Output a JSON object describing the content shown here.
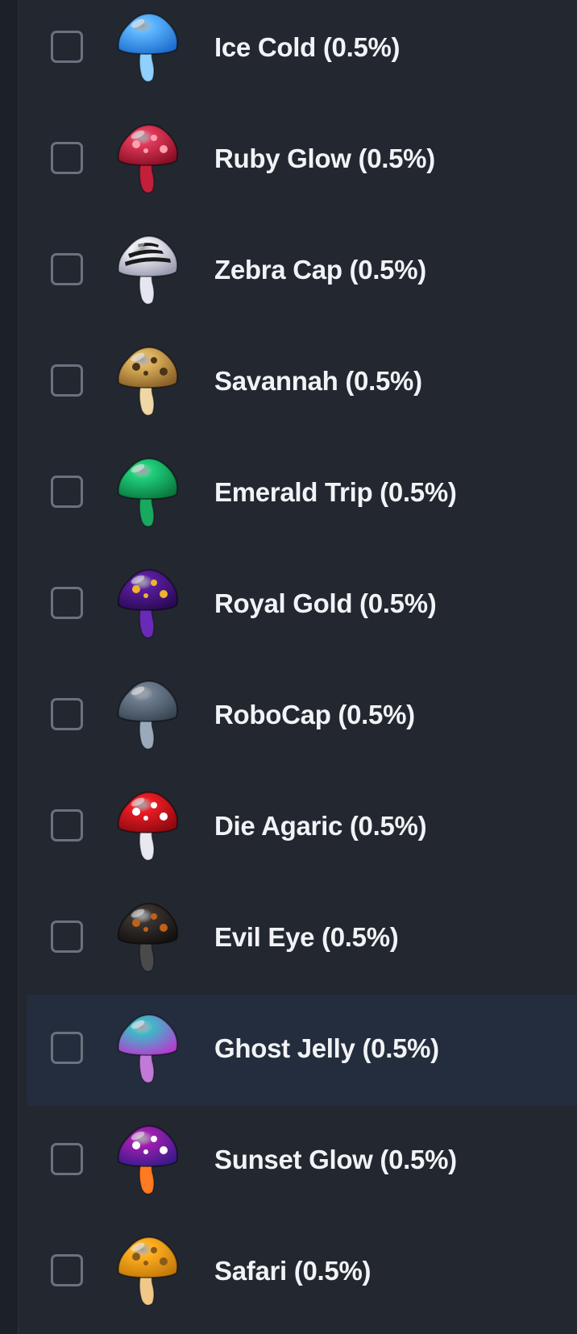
{
  "items": [
    {
      "label": "Ice Cold (0.5%)",
      "icon": "ice-cold-mushroom-icon",
      "cap": "#5fb8ff",
      "cap_dark": "#1f6fd0",
      "stem": "#8fd0ff",
      "spots": "",
      "checked": false,
      "highlighted": false
    },
    {
      "label": "Ruby Glow (0.5%)",
      "icon": "ruby-glow-mushroom-icon",
      "cap": "#e23a5a",
      "cap_dark": "#8a0f25",
      "stem": "#c21f3a",
      "spots": "#ff9fb0",
      "checked": false,
      "highlighted": false
    },
    {
      "label": "Zebra Cap (0.5%)",
      "icon": "zebra-cap-mushroom-icon",
      "cap": "#f2f2f8",
      "cap_dark": "#9a9ab0",
      "stem": "#e6e6f2",
      "spots": "#1a1a1a",
      "checked": false,
      "highlighted": false
    },
    {
      "label": "Savannah (0.5%)",
      "icon": "savannah-mushroom-icon",
      "cap": "#e0b45e",
      "cap_dark": "#8a6128",
      "stem": "#f0d7a6",
      "spots": "#4a3418",
      "checked": false,
      "highlighted": false
    },
    {
      "label": "Emerald Trip (0.5%)",
      "icon": "emerald-trip-mushroom-icon",
      "cap": "#1fcf7a",
      "cap_dark": "#0a7a40",
      "stem": "#19a85f",
      "spots": "",
      "checked": false,
      "highlighted": false
    },
    {
      "label": "Royal Gold (0.5%)",
      "icon": "royal-gold-mushroom-icon",
      "cap": "#5a1e9e",
      "cap_dark": "#2a0a55",
      "stem": "#6a2ab8",
      "spots": "#f0b230",
      "checked": false,
      "highlighted": false
    },
    {
      "label": "RoboCap (0.5%)",
      "icon": "robocap-mushroom-icon",
      "cap": "#6f7f90",
      "cap_dark": "#3a4654",
      "stem": "#9aaabb",
      "spots": "",
      "checked": false,
      "highlighted": false
    },
    {
      "label": "Die Agaric (0.5%)",
      "icon": "die-agaric-mushroom-icon",
      "cap": "#ee1c24",
      "cap_dark": "#8f0a10",
      "stem": "#e8e8f0",
      "spots": "#ffffff",
      "checked": false,
      "highlighted": false
    },
    {
      "label": "Evil Eye (0.5%)",
      "icon": "evil-eye-mushroom-icon",
      "cap": "#3a3330",
      "cap_dark": "#141110",
      "stem": "#4a4a4a",
      "spots": "#c0601a",
      "checked": false,
      "highlighted": false
    },
    {
      "label": "Ghost Jelly (0.5%)",
      "icon": "ghost-jelly-mushroom-icon",
      "cap": "#3fb8c8",
      "cap_dark": "#b23fd0",
      "stem": "#c27ad8",
      "spots": "",
      "checked": false,
      "highlighted": true
    },
    {
      "label": "Sunset Glow (0.5%)",
      "icon": "sunset-glow-mushroom-icon",
      "cap": "#a01fb0",
      "cap_dark": "#3a1a8a",
      "stem": "#ff7a20",
      "spots": "#ffffff",
      "checked": false,
      "highlighted": false
    },
    {
      "label": "Safari (0.5%)",
      "icon": "safari-mushroom-icon",
      "cap": "#ffb020",
      "cap_dark": "#c47a0a",
      "stem": "#f0c888",
      "spots": "#8a5a1a",
      "checked": false,
      "highlighted": false
    }
  ]
}
